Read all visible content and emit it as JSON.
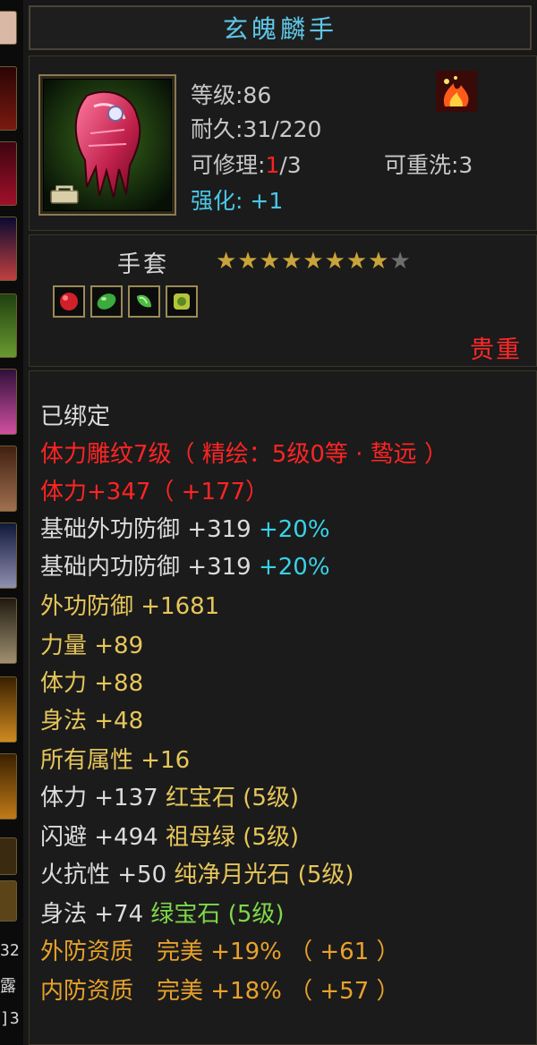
{
  "item": {
    "name": "玄魄麟手",
    "level": "等级:86",
    "durability": "耐久:31/220",
    "repair_prefix": "可修理:",
    "repair_used": "1",
    "repair_total": "/3",
    "rewash": "可重洗:3",
    "enhance_label": "强化:",
    "enhance_value": "+1",
    "type": "手套",
    "stars_filled": 8,
    "stars_total": 9,
    "rarity": "贵重"
  },
  "gems": [
    {
      "icon": "red-gem-icon",
      "color": "#d0202a"
    },
    {
      "icon": "green-gem-icon",
      "color": "#3caa3c"
    },
    {
      "icon": "green-gem-icon",
      "color": "#4dbb46"
    },
    {
      "icon": "yellow-green-gem-icon",
      "color": "#b5c43a"
    }
  ],
  "attributes": {
    "bound": "已绑定",
    "engrave": "体力雕纹7级（ 精绘：5级0等 · 鸷远 ）",
    "stamina_main": "体力+347（ +177）",
    "base_outer_def_label": "基础外功防御",
    "base_outer_def_val": "+319",
    "base_outer_def_pct": "+20%",
    "base_inner_def_label": "基础内功防御",
    "base_inner_def_val": "+319",
    "base_inner_def_pct": "+20%",
    "outer_def": "外功防御 +1681",
    "strength": "力量 +89",
    "stamina": "体力 +88",
    "agility": "身法 +48",
    "all_attr": "所有属性 +16",
    "gem_line_1_stat": "体力 +137",
    "gem_line_1_gem": "红宝石 (5级)",
    "gem_line_2_stat": "闪避 +494",
    "gem_line_2_gem": "祖母绿 (5级)",
    "gem_line_3_stat": "火抗性 +50",
    "gem_line_3_gem": "纯净月光石 (5级)",
    "gem_line_4_stat": "身法 +74",
    "gem_line_4_gem": "绿宝石 (5级)",
    "quality_outer": "外防资质　完美 +19% （ +61 ）",
    "quality_inner": "内防资质　完美 +18% （ +57 ）"
  },
  "sidebar": {
    "text_1": "32",
    "text_2": "露",
    "text_3": "]3"
  },
  "colors": {
    "title": "#5fc6e6",
    "red": "#ff2424",
    "yellow": "#e6c65a",
    "orange": "#e8a22c",
    "cyan": "#38d2e8",
    "green": "#7fd84a",
    "star": "#c9a43a"
  }
}
